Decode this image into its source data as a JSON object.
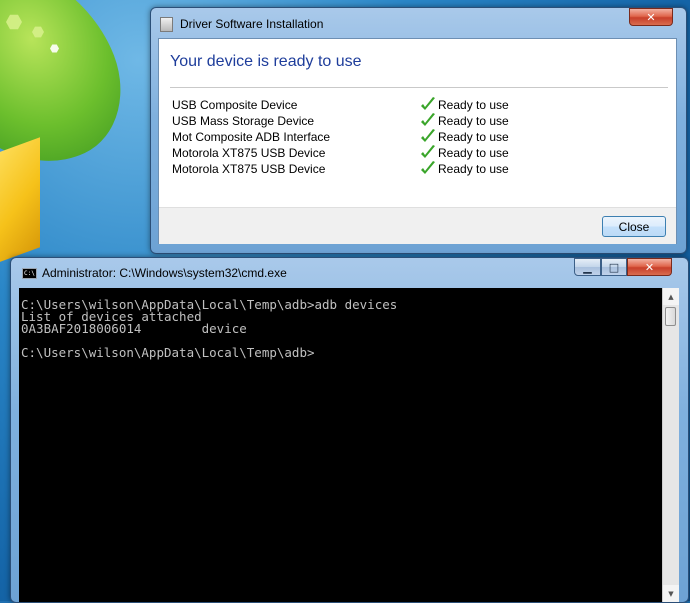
{
  "driver_dialog": {
    "title": "Driver Software Installation",
    "heading": "Your device is ready to use",
    "devices": [
      {
        "name": "USB Composite Device",
        "status": "Ready to use"
      },
      {
        "name": "USB Mass Storage Device",
        "status": "Ready to use"
      },
      {
        "name": "Mot Composite ADB Interface",
        "status": "Ready to use"
      },
      {
        "name": "Motorola XT875 USB Device",
        "status": "Ready to use"
      },
      {
        "name": "Motorola XT875 USB Device",
        "status": "Ready to use"
      }
    ],
    "close_label": "Close",
    "check_color": "#3aa52a"
  },
  "cmd_window": {
    "title": "Administrator: C:\\Windows\\system32\\cmd.exe",
    "icon_text": "C:\\",
    "lines": [
      "C:\\Users\\wilson\\AppData\\Local\\Temp\\adb>adb devices",
      "List of devices attached",
      "0A3BAF2018006014        device",
      "",
      "C:\\Users\\wilson\\AppData\\Local\\Temp\\adb>"
    ]
  }
}
